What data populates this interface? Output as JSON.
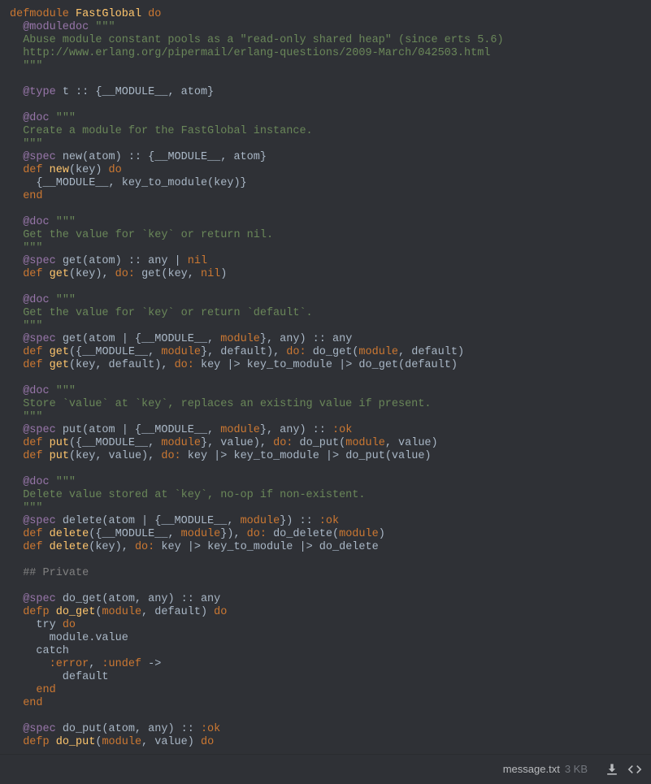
{
  "footer": {
    "filename": "message.txt",
    "filesize": "3 KB"
  },
  "code": {
    "lines": [
      [
        [
          "kw",
          "defmodule"
        ],
        [
          "pn",
          " "
        ],
        [
          "modname",
          "FastGlobal"
        ],
        [
          "pn",
          " "
        ],
        [
          "do",
          "do"
        ]
      ],
      [
        [
          "pn",
          "  "
        ],
        [
          "attr",
          "@moduledoc"
        ],
        [
          "pn",
          " "
        ],
        [
          "str",
          "\"\"\""
        ]
      ],
      [
        [
          "str",
          "  Abuse module constant pools as a \"read-only shared heap\" (since erts 5.6)"
        ]
      ],
      [
        [
          "str",
          "  http://www.erlang.org/pipermail/erlang-questions/2009-March/042503.html"
        ]
      ],
      [
        [
          "str",
          "  \"\"\""
        ]
      ],
      [],
      [
        [
          "pn",
          "  "
        ],
        [
          "attr",
          "@type"
        ],
        [
          "pn",
          " t :: {__MODULE__, atom}"
        ]
      ],
      [],
      [
        [
          "pn",
          "  "
        ],
        [
          "attr",
          "@doc"
        ],
        [
          "pn",
          " "
        ],
        [
          "str",
          "\"\"\""
        ]
      ],
      [
        [
          "str",
          "  Create a module for the FastGlobal instance."
        ]
      ],
      [
        [
          "str",
          "  \"\"\""
        ]
      ],
      [
        [
          "pn",
          "  "
        ],
        [
          "attr",
          "@spec"
        ],
        [
          "pn",
          " new(atom) :: {__MODULE__, atom}"
        ]
      ],
      [
        [
          "pn",
          "  "
        ],
        [
          "kw",
          "def"
        ],
        [
          "pn",
          " "
        ],
        [
          "fn",
          "new"
        ],
        [
          "pn",
          "(key) "
        ],
        [
          "do",
          "do"
        ]
      ],
      [
        [
          "pn",
          "    {__MODULE__, key_to_module(key)}"
        ]
      ],
      [
        [
          "pn",
          "  "
        ],
        [
          "do",
          "end"
        ]
      ],
      [],
      [
        [
          "pn",
          "  "
        ],
        [
          "attr",
          "@doc"
        ],
        [
          "pn",
          " "
        ],
        [
          "str",
          "\"\"\""
        ]
      ],
      [
        [
          "str",
          "  Get the value for `key` or return nil."
        ]
      ],
      [
        [
          "str",
          "  \"\"\""
        ]
      ],
      [
        [
          "pn",
          "  "
        ],
        [
          "attr",
          "@spec"
        ],
        [
          "pn",
          " get(atom) :: any | "
        ],
        [
          "nil",
          "nil"
        ]
      ],
      [
        [
          "pn",
          "  "
        ],
        [
          "kw",
          "def"
        ],
        [
          "pn",
          " "
        ],
        [
          "fn",
          "get"
        ],
        [
          "pn",
          "(key), "
        ],
        [
          "dockw",
          "do:"
        ],
        [
          "pn",
          " get(key, "
        ],
        [
          "nil",
          "nil"
        ],
        [
          "pn",
          ")"
        ]
      ],
      [],
      [
        [
          "pn",
          "  "
        ],
        [
          "attr",
          "@doc"
        ],
        [
          "pn",
          " "
        ],
        [
          "str",
          "\"\"\""
        ]
      ],
      [
        [
          "str",
          "  Get the value for `key` or return `default`."
        ]
      ],
      [
        [
          "str",
          "  \"\"\""
        ]
      ],
      [
        [
          "pn",
          "  "
        ],
        [
          "attr",
          "@spec"
        ],
        [
          "pn",
          " get(atom | {__MODULE__, "
        ],
        [
          "param",
          "module"
        ],
        [
          "pn",
          "}, any) :: any"
        ]
      ],
      [
        [
          "pn",
          "  "
        ],
        [
          "kw",
          "def"
        ],
        [
          "pn",
          " "
        ],
        [
          "fn",
          "get"
        ],
        [
          "pn",
          "({__MODULE__, "
        ],
        [
          "param",
          "module"
        ],
        [
          "pn",
          "}, default), "
        ],
        [
          "dockw",
          "do:"
        ],
        [
          "pn",
          " do_get("
        ],
        [
          "param",
          "module"
        ],
        [
          "pn",
          ", default)"
        ]
      ],
      [
        [
          "pn",
          "  "
        ],
        [
          "kw",
          "def"
        ],
        [
          "pn",
          " "
        ],
        [
          "fn",
          "get"
        ],
        [
          "pn",
          "(key, default), "
        ],
        [
          "dockw",
          "do:"
        ],
        [
          "pn",
          " key |> key_to_module |> do_get(default)"
        ]
      ],
      [],
      [
        [
          "pn",
          "  "
        ],
        [
          "attr",
          "@doc"
        ],
        [
          "pn",
          " "
        ],
        [
          "str",
          "\"\"\""
        ]
      ],
      [
        [
          "str",
          "  Store `value` at `key`, replaces an existing value if present."
        ]
      ],
      [
        [
          "str",
          "  \"\"\""
        ]
      ],
      [
        [
          "pn",
          "  "
        ],
        [
          "attr",
          "@spec"
        ],
        [
          "pn",
          " put(atom | {__MODULE__, "
        ],
        [
          "param",
          "module"
        ],
        [
          "pn",
          "}, any) :: "
        ],
        [
          "atom",
          ":ok"
        ]
      ],
      [
        [
          "pn",
          "  "
        ],
        [
          "kw",
          "def"
        ],
        [
          "pn",
          " "
        ],
        [
          "fn",
          "put"
        ],
        [
          "pn",
          "({__MODULE__, "
        ],
        [
          "param",
          "module"
        ],
        [
          "pn",
          "}, value), "
        ],
        [
          "dockw",
          "do:"
        ],
        [
          "pn",
          " do_put("
        ],
        [
          "param",
          "module"
        ],
        [
          "pn",
          ", value)"
        ]
      ],
      [
        [
          "pn",
          "  "
        ],
        [
          "kw",
          "def"
        ],
        [
          "pn",
          " "
        ],
        [
          "fn",
          "put"
        ],
        [
          "pn",
          "(key, value), "
        ],
        [
          "dockw",
          "do:"
        ],
        [
          "pn",
          " key |> key_to_module |> do_put(value)"
        ]
      ],
      [],
      [
        [
          "pn",
          "  "
        ],
        [
          "attr",
          "@doc"
        ],
        [
          "pn",
          " "
        ],
        [
          "str",
          "\"\"\""
        ]
      ],
      [
        [
          "str",
          "  Delete value stored at `key`, no-op if non-existent."
        ]
      ],
      [
        [
          "str",
          "  \"\"\""
        ]
      ],
      [
        [
          "pn",
          "  "
        ],
        [
          "attr",
          "@spec"
        ],
        [
          "pn",
          " delete(atom | {__MODULE__, "
        ],
        [
          "param",
          "module"
        ],
        [
          "pn",
          "}) :: "
        ],
        [
          "atom",
          ":ok"
        ]
      ],
      [
        [
          "pn",
          "  "
        ],
        [
          "kw",
          "def"
        ],
        [
          "pn",
          " "
        ],
        [
          "fn",
          "delete"
        ],
        [
          "pn",
          "({__MODULE__, "
        ],
        [
          "param",
          "module"
        ],
        [
          "pn",
          "}), "
        ],
        [
          "dockw",
          "do:"
        ],
        [
          "pn",
          " do_delete("
        ],
        [
          "param",
          "module"
        ],
        [
          "pn",
          ")"
        ]
      ],
      [
        [
          "pn",
          "  "
        ],
        [
          "kw",
          "def"
        ],
        [
          "pn",
          " "
        ],
        [
          "fn",
          "delete"
        ],
        [
          "pn",
          "(key), "
        ],
        [
          "dockw",
          "do:"
        ],
        [
          "pn",
          " key |> key_to_module |> do_delete"
        ]
      ],
      [],
      [
        [
          "pn",
          "  "
        ],
        [
          "cmt",
          "## Private"
        ]
      ],
      [],
      [
        [
          "pn",
          "  "
        ],
        [
          "attr",
          "@spec"
        ],
        [
          "pn",
          " do_get(atom, any) :: any"
        ]
      ],
      [
        [
          "pn",
          "  "
        ],
        [
          "kw",
          "defp"
        ],
        [
          "pn",
          " "
        ],
        [
          "fn",
          "do_get"
        ],
        [
          "pn",
          "("
        ],
        [
          "param",
          "module"
        ],
        [
          "pn",
          ", default) "
        ],
        [
          "do",
          "do"
        ]
      ],
      [
        [
          "pn",
          "    try "
        ],
        [
          "do",
          "do"
        ]
      ],
      [
        [
          "pn",
          "      module.value"
        ]
      ],
      [
        [
          "pn",
          "    catch"
        ]
      ],
      [
        [
          "pn",
          "      "
        ],
        [
          "atom",
          ":error"
        ],
        [
          "pn",
          ", "
        ],
        [
          "atom",
          ":undef"
        ],
        [
          "pn",
          " ->"
        ]
      ],
      [
        [
          "pn",
          "        default"
        ]
      ],
      [
        [
          "pn",
          "    "
        ],
        [
          "do",
          "end"
        ]
      ],
      [
        [
          "pn",
          "  "
        ],
        [
          "do",
          "end"
        ]
      ],
      [],
      [
        [
          "pn",
          "  "
        ],
        [
          "attr",
          "@spec"
        ],
        [
          "pn",
          " do_put(atom, any) :: "
        ],
        [
          "atom",
          ":ok"
        ]
      ],
      [
        [
          "pn",
          "  "
        ],
        [
          "kw",
          "defp"
        ],
        [
          "pn",
          " "
        ],
        [
          "fn",
          "do_put"
        ],
        [
          "pn",
          "("
        ],
        [
          "param",
          "module"
        ],
        [
          "pn",
          ", value) "
        ],
        [
          "do",
          "do"
        ]
      ]
    ]
  }
}
